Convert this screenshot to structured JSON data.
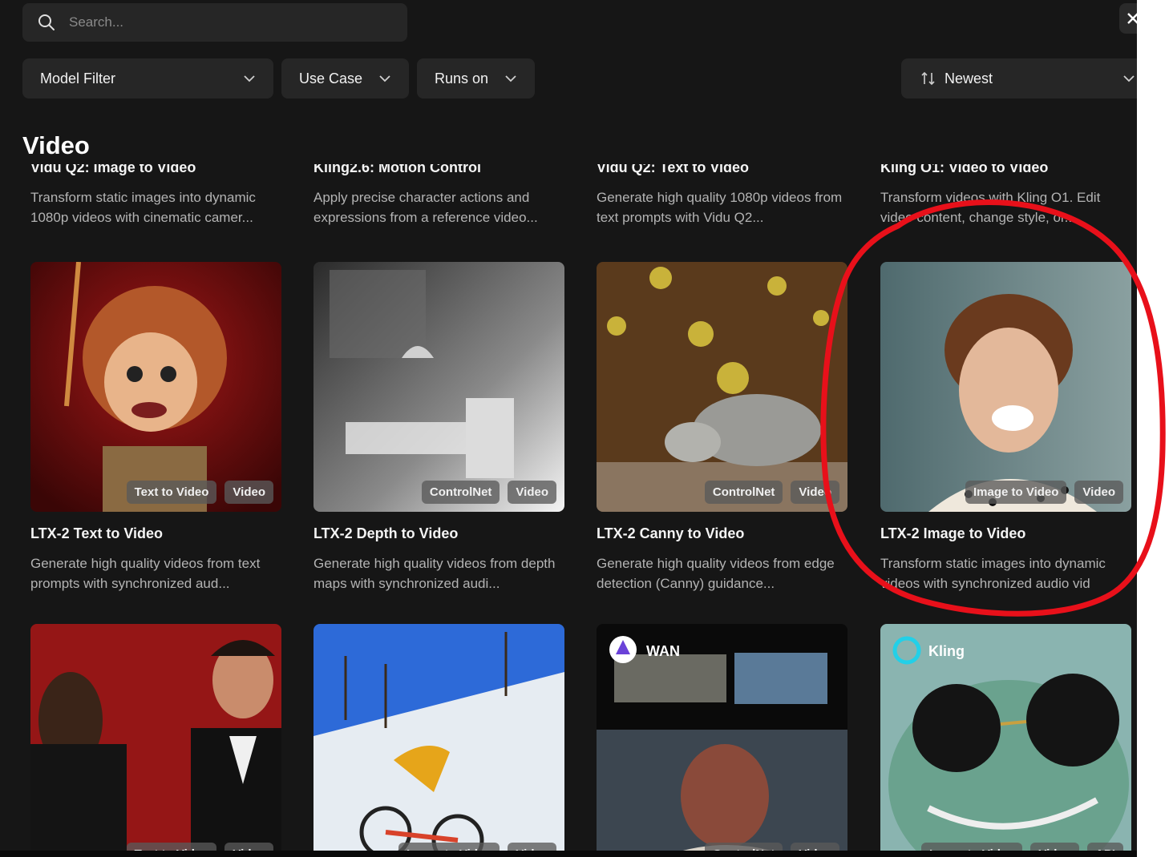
{
  "search": {
    "placeholder": "Search..."
  },
  "filters": {
    "model_filter": "Model Filter",
    "use_case": "Use Case",
    "runs_on": "Runs on",
    "sort": "Newest"
  },
  "section": {
    "title": "Video"
  },
  "row1": [
    {
      "title": "Vidu Q2: Image to Video",
      "desc": "Transform static images into dynamic 1080p videos with cinematic camer..."
    },
    {
      "title": "Kling2.6: Motion Control",
      "desc": "Apply precise character actions and expressions from a reference video..."
    },
    {
      "title": "Vidu Q2: Text to Video",
      "desc": "Generate high quality 1080p videos from text prompts with Vidu Q2..."
    },
    {
      "title": "Kling O1: Video to Video",
      "desc": "Transform videos with Kling O1. Edit video content, change style, or..."
    }
  ],
  "row2": [
    {
      "title": "LTX-2 Text to Video",
      "desc": "Generate high quality videos from text prompts with synchronized aud...",
      "tags": [
        "Text to Video",
        "Video"
      ]
    },
    {
      "title": "LTX-2 Depth to Video",
      "desc": "Generate high quality videos from depth maps with synchronized audi...",
      "tags": [
        "ControlNet",
        "Video"
      ]
    },
    {
      "title": "LTX-2 Canny to Video",
      "desc": "Generate high quality videos from edge detection (Canny) guidance...",
      "tags": [
        "ControlNet",
        "Video"
      ]
    },
    {
      "title": "LTX-2 Image to Video",
      "desc": "Transform static images into dynamic videos with synchronized audio vid",
      "tags": [
        "Image to Video",
        "Video"
      ]
    }
  ],
  "row3": [
    {
      "tags": [
        "Text to Video",
        "Video"
      ]
    },
    {
      "tags": [
        "Image to Video",
        "Video"
      ]
    },
    {
      "brand": "WAN",
      "tags": [
        "ControlNet",
        "Video"
      ]
    },
    {
      "brand": "Kling",
      "tags": [
        "Image to Video",
        "Video",
        "API"
      ]
    }
  ],
  "colors": {
    "background": "#161616",
    "surface": "#262626",
    "annotation": "#e8101a"
  }
}
